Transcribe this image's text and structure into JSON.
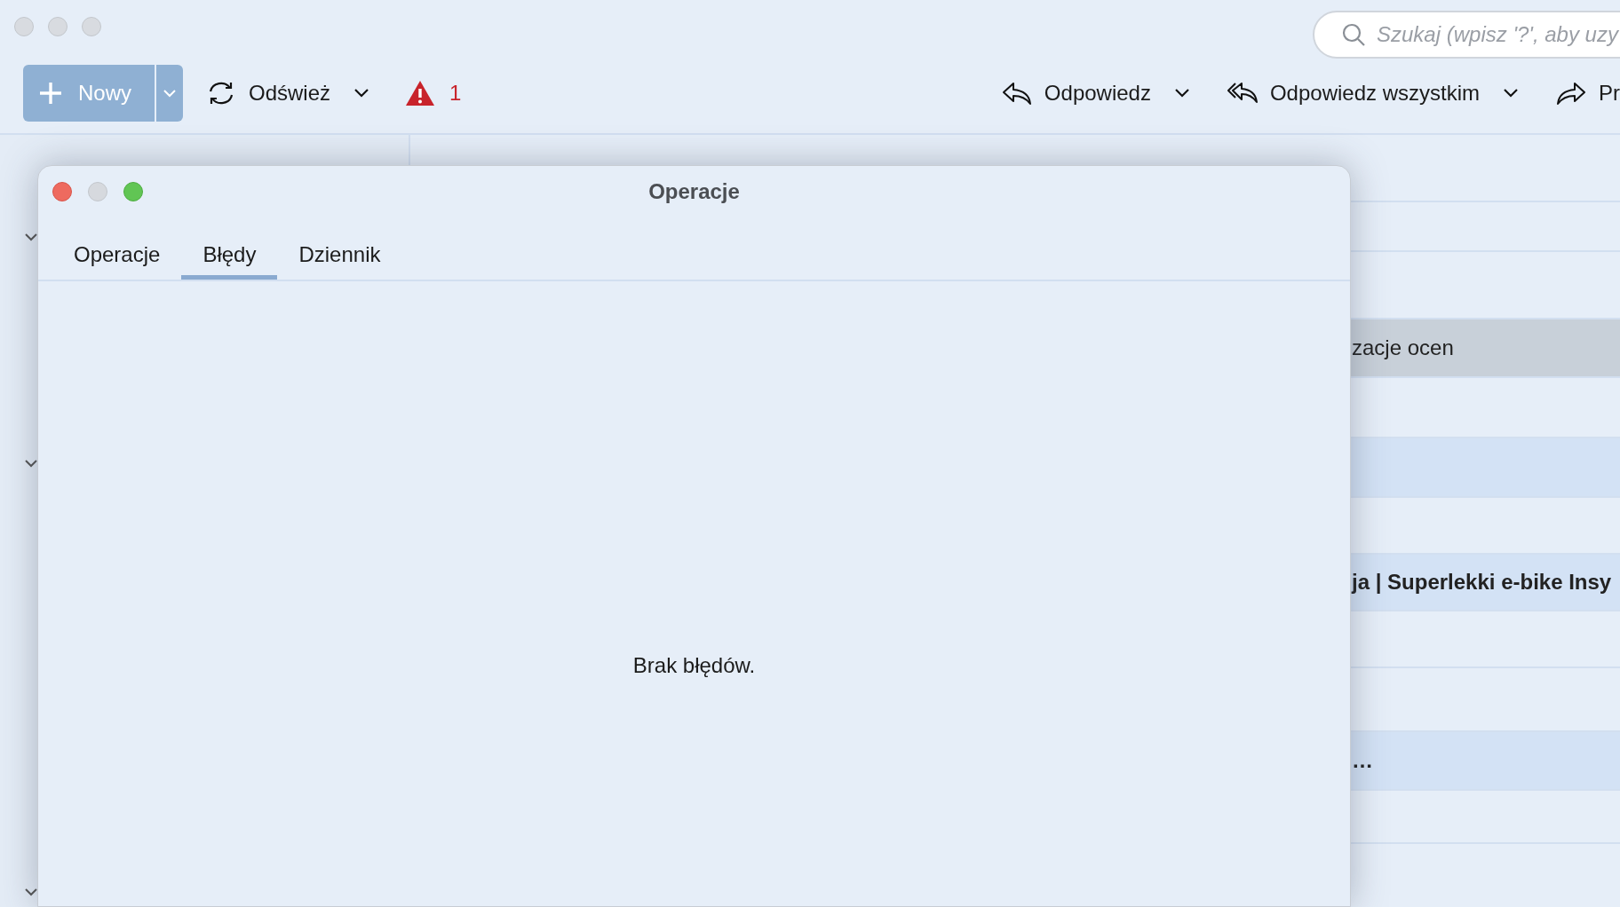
{
  "toolbar": {
    "new_button": "Nowy",
    "refresh_button": "Odśwież",
    "alert_count": "1",
    "reply_button": "Odpowiedz",
    "reply_all_button": "Odpowiedz wszystkim",
    "forward_button": "Pr"
  },
  "search": {
    "placeholder": "Szukaj (wpisz '?', aby uzy"
  },
  "message_list": {
    "rows": [
      {
        "selected": false,
        "unread": false
      },
      {
        "selected": false,
        "unread": false
      },
      {
        "selected": false,
        "unread": false
      },
      {
        "selected": true,
        "unread": false,
        "text": "zacje ocen"
      },
      {
        "selected": false,
        "unread": false
      },
      {
        "selected": false,
        "unread": true
      },
      {
        "selected": false,
        "unread": false
      },
      {
        "selected": false,
        "unread": true,
        "text": "ja | Superlekki e-bike Insy"
      },
      {
        "selected": false,
        "unread": false
      },
      {
        "selected": false,
        "unread": false
      },
      {
        "selected": false,
        "unread": true,
        "text": "…"
      },
      {
        "selected": false,
        "unread": false
      }
    ]
  },
  "dialog": {
    "title": "Operacje",
    "tabs": [
      {
        "label": "Operacje",
        "selected": false
      },
      {
        "label": "Błędy",
        "selected": true
      },
      {
        "label": "Dziennik",
        "selected": false
      }
    ],
    "empty_message": "Brak błędów."
  }
}
